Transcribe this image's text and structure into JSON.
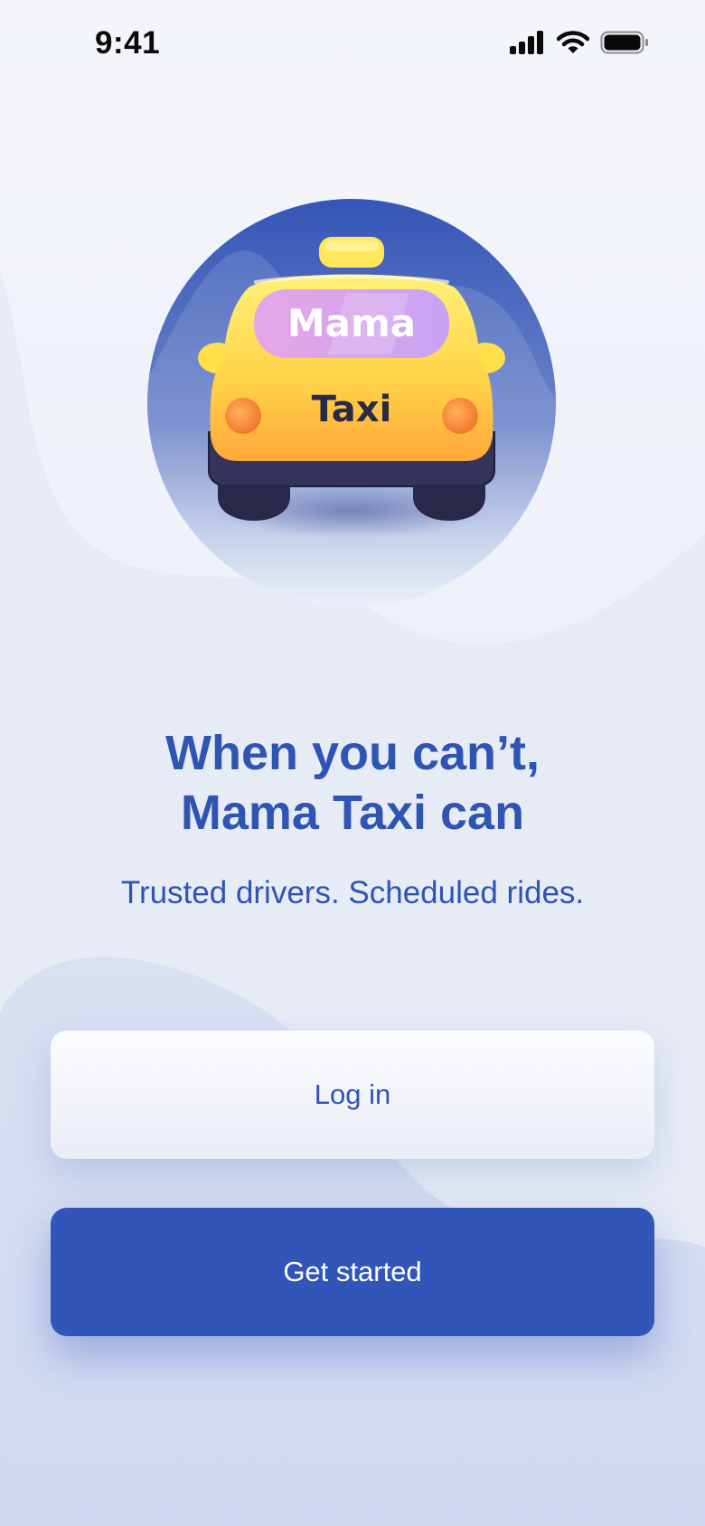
{
  "status_bar": {
    "time": "9:41",
    "icons": [
      "signal-icon",
      "wifi-icon",
      "battery-icon"
    ]
  },
  "hero": {
    "taxi_sign_top": "Mama",
    "taxi_plate": "Taxi",
    "circle_color": "#3b5cb8",
    "car_color": "#ffd74a",
    "window_color": "#d9a7f0"
  },
  "headline": {
    "line1": "When you can’t,",
    "line2": "Mama Taxi can"
  },
  "subtitle": "Trusted drivers. Scheduled rides.",
  "buttons": {
    "login": "Log in",
    "get_started": "Get started"
  },
  "colors": {
    "primary": "#3155b8",
    "text_accent": "#2f55b4",
    "background": "#eef1f8"
  }
}
